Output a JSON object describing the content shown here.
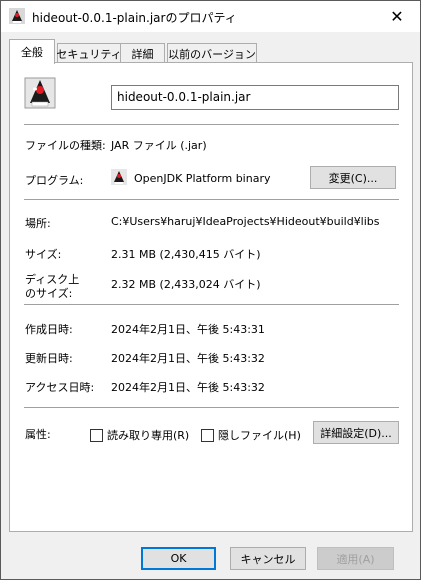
{
  "window": {
    "title": "hideout-0.0.1-plain.jarのプロパティ",
    "close_glyph": "✕"
  },
  "tabs": [
    {
      "label": "全般",
      "active": true
    },
    {
      "label": "セキュリティ",
      "active": false
    },
    {
      "label": "詳細",
      "active": false
    },
    {
      "label": "以前のバージョン",
      "active": false
    }
  ],
  "general": {
    "filename": "hideout-0.0.1-plain.jar",
    "file_type_label": "ファイルの種類:",
    "file_type_value": "JAR ファイル (.jar)",
    "program_label": "プログラム:",
    "program_value": "OpenJDK Platform binary",
    "change_button": "変更(C)...",
    "location_label": "場所:",
    "location_value": "C:¥Users¥haruj¥IdeaProjects¥Hideout¥build¥libs",
    "size_label": "サイズ:",
    "size_value": "2.31 MB (2,430,415 バイト)",
    "disk_size_label_line1": "ディスク上",
    "disk_size_label_line2": "のサイズ:",
    "disk_size_value": "2.32 MB (2,433,024 バイト)",
    "created_label": "作成日時:",
    "created_value": "2024年2月1日、午後 5:43:31",
    "modified_label": "更新日時:",
    "modified_value": "2024年2月1日、午後 5:43:32",
    "accessed_label": "アクセス日時:",
    "accessed_value": "2024年2月1日、午後 5:43:32",
    "attributes_label": "属性:",
    "readonly_label": "読み取り専用(R)",
    "readonly_checked": false,
    "hidden_label": "隠しファイル(H)",
    "hidden_checked": false,
    "advanced_button": "詳細設定(D)..."
  },
  "footer": {
    "ok": "OK",
    "cancel": "キャンセル",
    "apply": "適用(A)"
  },
  "icons": {
    "app": "java-duke-icon",
    "close": "close-icon"
  },
  "colors": {
    "accent": "#0078d7",
    "panel_bg": "#ffffff",
    "window_bg": "#f0f0f0"
  }
}
